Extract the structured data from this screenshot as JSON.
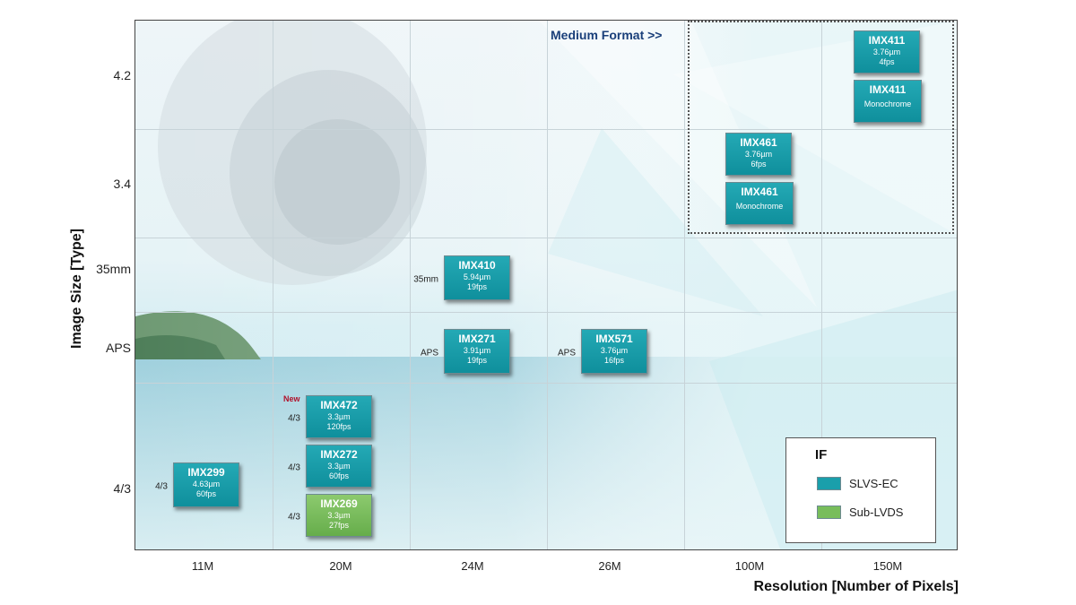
{
  "chart_data": {
    "type": "table",
    "xlabel": "Resolution  [Number of Pixels]",
    "ylabel": "Image Size [Type]",
    "x_categories": [
      "11M",
      "20M",
      "24M",
      "26M",
      "100M",
      "150M"
    ],
    "y_categories": [
      "4/3",
      "APS",
      "35mm",
      "3.4",
      "4.2"
    ],
    "region_label": "Medium Format >>",
    "legend": {
      "title": "IF",
      "items": [
        {
          "label": "SLVS-EC",
          "color": "#1a9fab"
        },
        {
          "label": "Sub-LVDS",
          "color": "#78bd5b"
        }
      ]
    },
    "sensors": [
      {
        "name": "IMX299",
        "lines": [
          "4.63µm",
          "60fps"
        ],
        "x": "11M",
        "y": "4/3",
        "tag": "4/3",
        "interface": "SLVS-EC",
        "new": false
      },
      {
        "name": "IMX472",
        "lines": [
          "3.3µm",
          "120fps"
        ],
        "x": "20M",
        "y": "4/3",
        "tag": "4/3",
        "interface": "SLVS-EC",
        "new": true
      },
      {
        "name": "IMX272",
        "lines": [
          "3.3µm",
          "60fps"
        ],
        "x": "20M",
        "y": "4/3",
        "tag": "4/3",
        "interface": "SLVS-EC",
        "new": false
      },
      {
        "name": "IMX269",
        "lines": [
          "3.3µm",
          "27fps"
        ],
        "x": "20M",
        "y": "4/3",
        "tag": "4/3",
        "interface": "Sub-LVDS",
        "new": false
      },
      {
        "name": "IMX410",
        "lines": [
          "5.94µm",
          "19fps"
        ],
        "x": "24M",
        "y": "35mm",
        "tag": "35mm",
        "interface": "SLVS-EC",
        "new": false
      },
      {
        "name": "IMX271",
        "lines": [
          "3.91µm",
          "19fps"
        ],
        "x": "24M",
        "y": "APS",
        "tag": "APS",
        "interface": "SLVS-EC",
        "new": false
      },
      {
        "name": "IMX571",
        "lines": [
          "3.76µm",
          "16fps"
        ],
        "x": "26M",
        "y": "APS",
        "tag": "APS",
        "interface": "SLVS-EC",
        "new": false
      },
      {
        "name": "IMX461",
        "lines": [
          "3.76µm",
          "6fps"
        ],
        "x": "100M",
        "y": "3.4",
        "tag": "",
        "interface": "SLVS-EC",
        "new": false
      },
      {
        "name": "IMX461",
        "lines": [
          "Monochrome"
        ],
        "x": "100M",
        "y": "3.4",
        "tag": "",
        "interface": "SLVS-EC",
        "new": false
      },
      {
        "name": "IMX411",
        "lines": [
          "3.76µm",
          "4fps"
        ],
        "x": "150M",
        "y": "4.2",
        "tag": "",
        "interface": "SLVS-EC",
        "new": false
      },
      {
        "name": "IMX411",
        "lines": [
          "Monochrome"
        ],
        "x": "150M",
        "y": "4.2",
        "tag": "",
        "interface": "SLVS-EC",
        "new": false
      }
    ],
    "new_label": "New"
  }
}
